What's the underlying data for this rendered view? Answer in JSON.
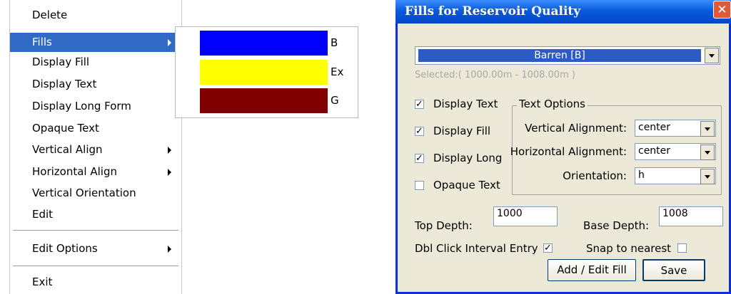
{
  "context_menu": {
    "items": [
      {
        "label": "Delete"
      },
      {
        "label": "Fills"
      },
      {
        "label": "Display Fill"
      },
      {
        "label": "Display Text"
      },
      {
        "label": "Display Long Form"
      },
      {
        "label": "Opaque Text"
      },
      {
        "label": "Vertical Align"
      },
      {
        "label": "Horizontal Align"
      },
      {
        "label": "Vertical Orientation"
      },
      {
        "label": "Edit"
      },
      {
        "label": "Edit Options"
      },
      {
        "label": "Exit"
      }
    ]
  },
  "fills_submenu": {
    "items": [
      {
        "label": "B",
        "color": "#0000ff"
      },
      {
        "label": "Ex",
        "color": "#ffff00"
      },
      {
        "label": "G",
        "color": "#800000"
      }
    ]
  },
  "dialog": {
    "title": "Fills for Reservoir Quality",
    "close_glyph": "✕",
    "fill_combo_value": "Barren [B]",
    "selected_range": "Selected:( 1000.00m - 1008.00m )",
    "display_text": {
      "label": "Display Text",
      "checked": "✓"
    },
    "display_fill": {
      "label": "Display Fill",
      "checked": "✓"
    },
    "display_long": {
      "label": "Display Long",
      "checked": "✓"
    },
    "opaque_text": {
      "label": "Opaque Text",
      "checked": ""
    },
    "text_options": {
      "title": "Text Options",
      "vertical_alignment_label": "Vertical Alignment:",
      "vertical_alignment_value": "center",
      "horizontal_alignment_label": "Horizontal Alignment:",
      "horizontal_alignment_value": "center",
      "orientation_label": "Orientation:",
      "orientation_value": "h"
    },
    "top_depth_label": "Top Depth:",
    "top_depth_value": "1000",
    "base_depth_label": "Base Depth:",
    "base_depth_value": "1008",
    "dbl_click_label": "Dbl Click Interval Entry",
    "dbl_click_checked": "✓",
    "snap_label": "Snap to nearest",
    "snap_checked": "",
    "add_edit_button": "Add / Edit Fill",
    "save_button": "Save"
  },
  "colors": {
    "highlight": "#316ac5",
    "titlebar": "#0a5adc",
    "dialog_bg": "#ece9d8",
    "fill_bar": "#2d5bc6"
  }
}
